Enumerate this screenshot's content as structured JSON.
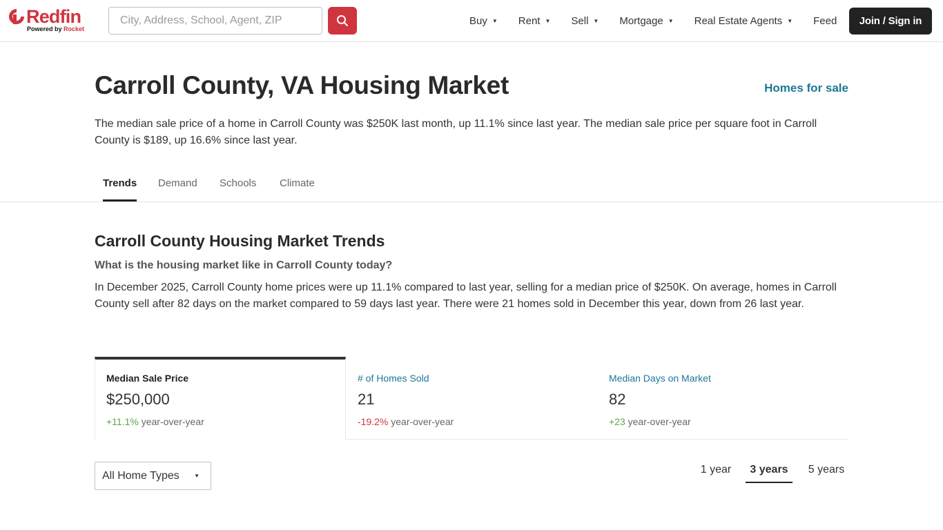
{
  "header": {
    "logo_text": "Redfin",
    "logo_powered": "Powered by",
    "logo_partner": "Rocket",
    "search_placeholder": "City, Address, School, Agent, ZIP",
    "nav": [
      {
        "label": "Buy",
        "has_dropdown": true
      },
      {
        "label": "Rent",
        "has_dropdown": true
      },
      {
        "label": "Sell",
        "has_dropdown": true
      },
      {
        "label": "Mortgage",
        "has_dropdown": true
      },
      {
        "label": "Real Estate Agents",
        "has_dropdown": true
      },
      {
        "label": "Feed",
        "has_dropdown": false
      }
    ],
    "join_label": "Join / Sign in"
  },
  "page": {
    "title": "Carroll County, VA Housing Market",
    "homes_link": "Homes for sale",
    "intro": "The median sale price of a home in Carroll County was $250K last month, up 11.1% since last year. The median sale price per square foot in Carroll County is $189, up 16.6% since last year."
  },
  "tabs": [
    {
      "label": "Trends",
      "active": true
    },
    {
      "label": "Demand",
      "active": false
    },
    {
      "label": "Schools",
      "active": false
    },
    {
      "label": "Climate",
      "active": false
    }
  ],
  "trends": {
    "title": "Carroll County Housing Market Trends",
    "question": "What is the housing market like in Carroll County today?",
    "body": "In December 2025, Carroll County home prices were up 11.1% compared to last year, selling for a median price of $250K. On average, homes in Carroll County sell after 82 days on the market compared to 59 days last year. There were 21 homes sold in December this year, down from 26 last year."
  },
  "stats": [
    {
      "label": "Median Sale Price",
      "value": "$250,000",
      "change": "+11.1%",
      "change_dir": "up",
      "suffix": "year-over-year",
      "active": true
    },
    {
      "label": "# of Homes Sold",
      "value": "21",
      "change": "-19.2%",
      "change_dir": "down",
      "suffix": "year-over-year",
      "active": false
    },
    {
      "label": "Median Days on Market",
      "value": "82",
      "change": "+23",
      "change_dir": "up",
      "suffix": "year-over-year",
      "active": false
    }
  ],
  "controls": {
    "home_type": "All Home Types",
    "ranges": [
      {
        "label": "1 year",
        "active": false
      },
      {
        "label": "3 years",
        "active": true
      },
      {
        "label": "5 years",
        "active": false
      }
    ]
  },
  "colors": {
    "brand": "#d0343f",
    "link": "#1a7896",
    "positive": "#5aa646",
    "negative": "#d0343f"
  }
}
